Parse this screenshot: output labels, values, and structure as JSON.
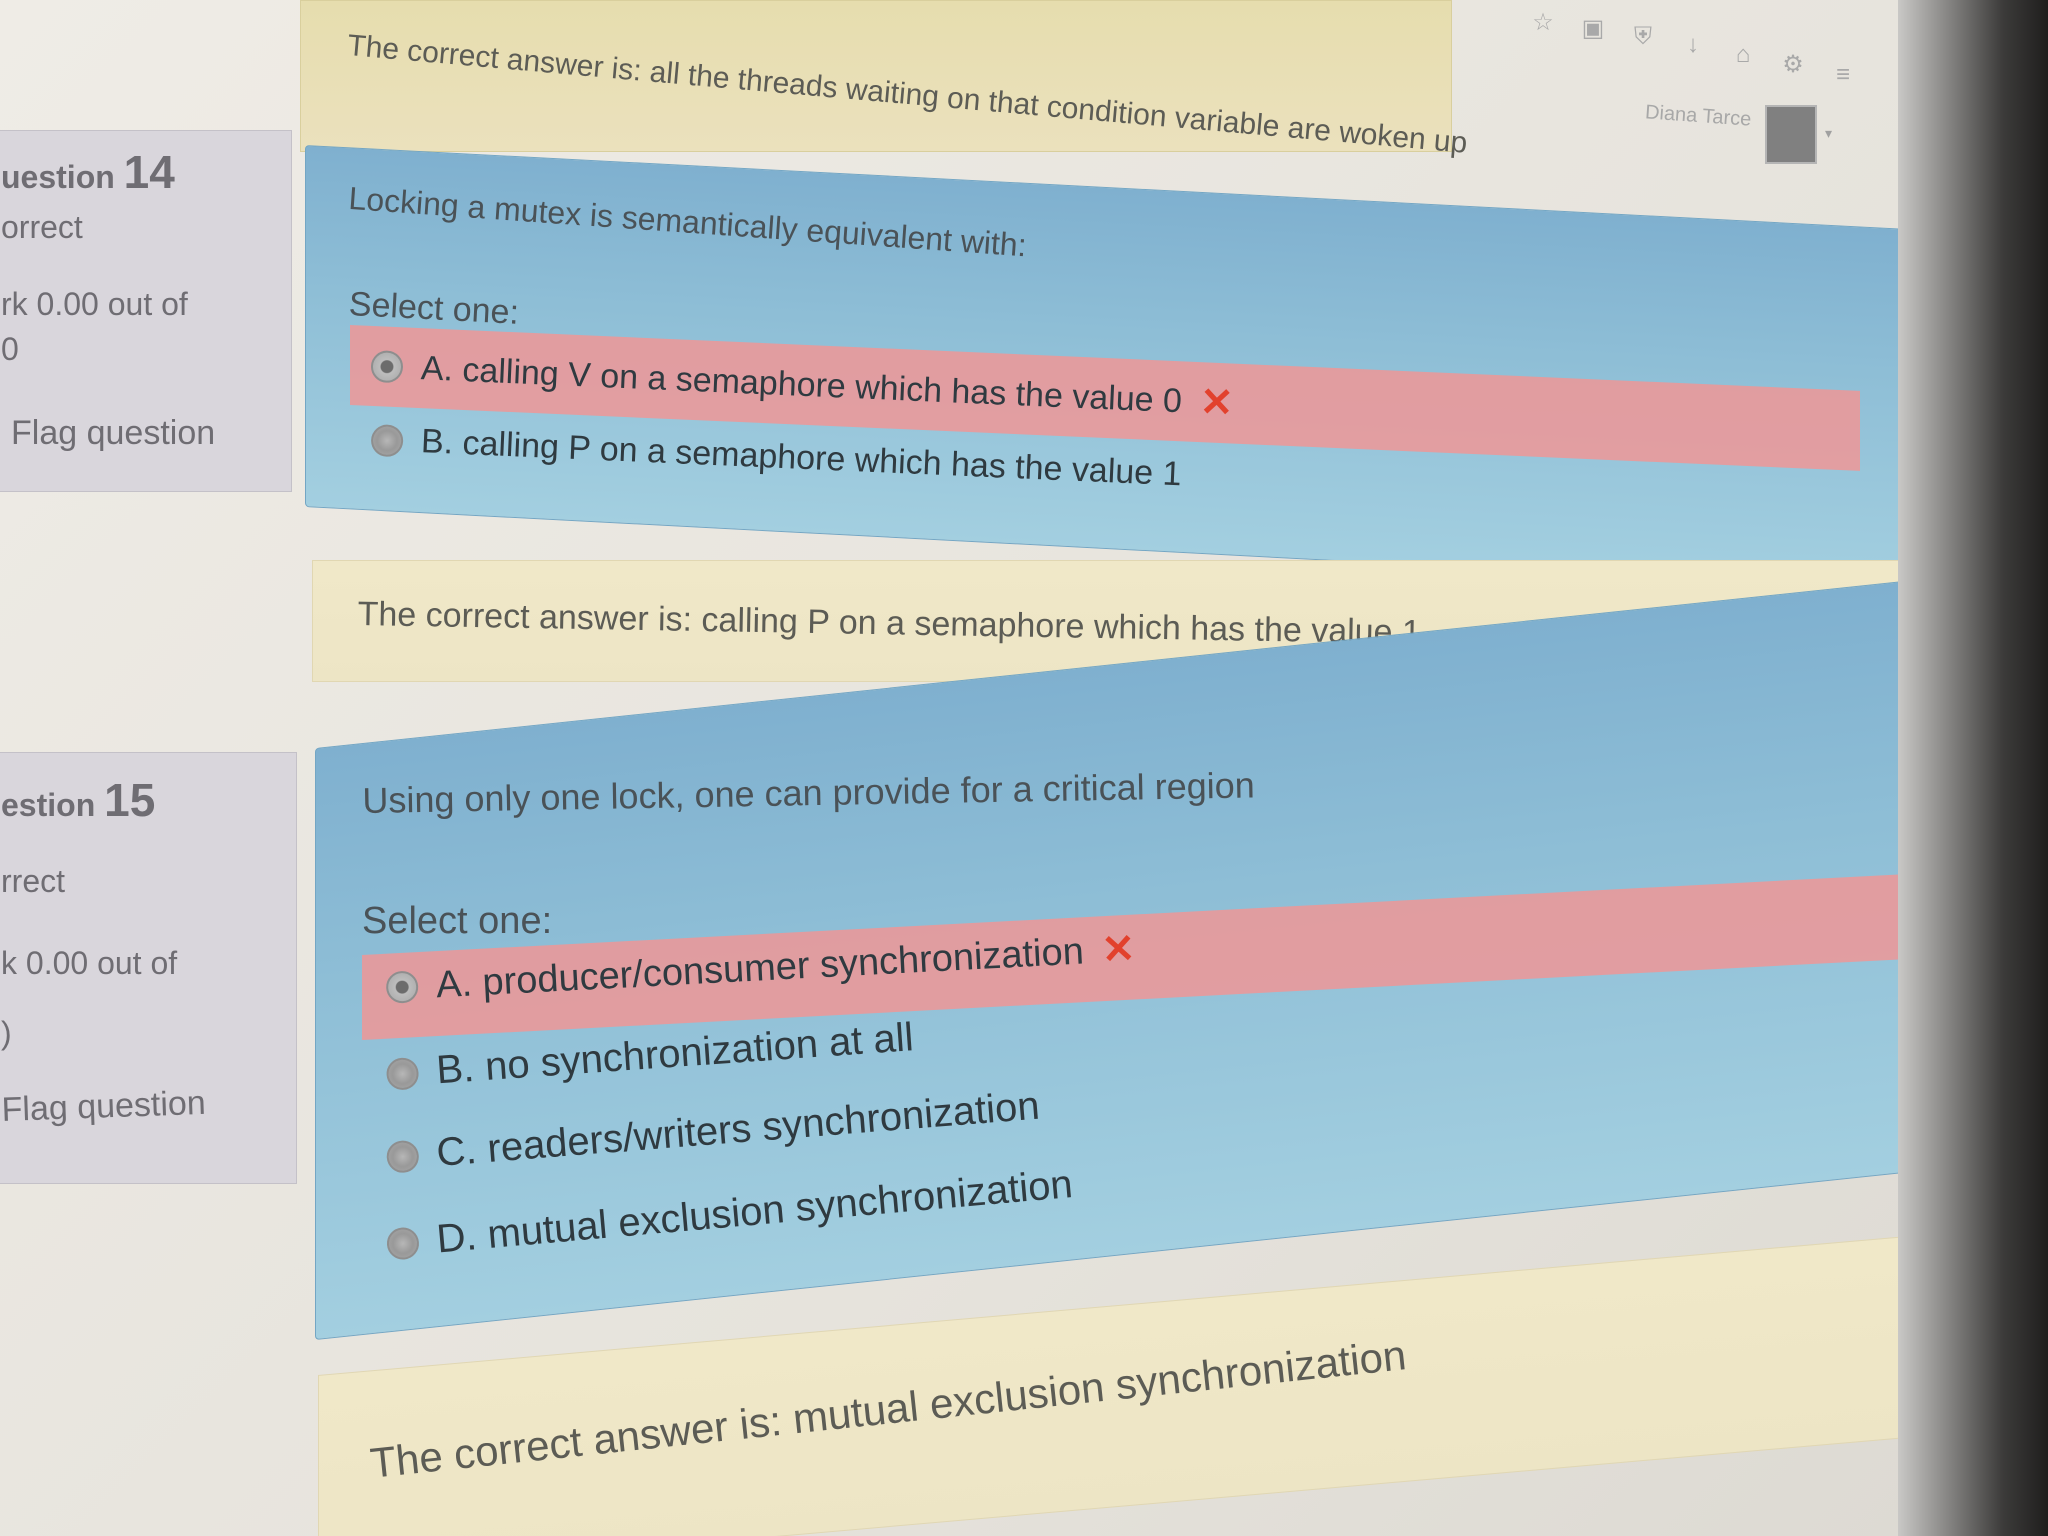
{
  "header": {
    "user_name": "Diana Tarce",
    "icons": [
      "star-icon",
      "clipboard-icon",
      "shield-icon",
      "download-icon",
      "home-icon",
      "settings-icon",
      "menu-icon"
    ]
  },
  "previous_feedback": "The correct answer is: all the threads waiting on that condition variable are woken up",
  "questions": [
    {
      "label": "uestion",
      "number": "14",
      "state": "orrect",
      "mark_line1": "rk 0.00 out of",
      "mark_line2": "0",
      "flag_label": "Flag question",
      "text": "Locking a mutex is semantically equivalent with:",
      "prompt": "Select one:",
      "options": [
        {
          "label": "A. calling V on a semaphore which has the value 0",
          "selected": true,
          "incorrect": true
        },
        {
          "label": "B. calling P on a semaphore which has the value 1",
          "selected": false,
          "incorrect": false
        }
      ],
      "feedback": "The correct answer is: calling P on a semaphore which has the value 1"
    },
    {
      "label": "estion",
      "number": "15",
      "state": "rrect",
      "mark_line1": "k 0.00 out of",
      "mark_line2": ")",
      "flag_label": "Flag question",
      "text": "Using only one lock, one can provide for a critical region",
      "prompt": "Select one:",
      "options": [
        {
          "label": "A. producer/consumer synchronization",
          "selected": true,
          "incorrect": true
        },
        {
          "label": "B. no synchronization at all",
          "selected": false,
          "incorrect": false
        },
        {
          "label": "C. readers/writers synchronization",
          "selected": false,
          "incorrect": false
        },
        {
          "label": "D. mutual exclusion synchronization",
          "selected": false,
          "incorrect": false
        }
      ],
      "feedback": "The correct answer is: mutual exclusion synchronization"
    }
  ],
  "colors": {
    "question_panel": "#8ebed6",
    "incorrect_band": "#ef9696",
    "feedback_panel": "#f0e8c8",
    "x_mark": "#e2412d"
  }
}
